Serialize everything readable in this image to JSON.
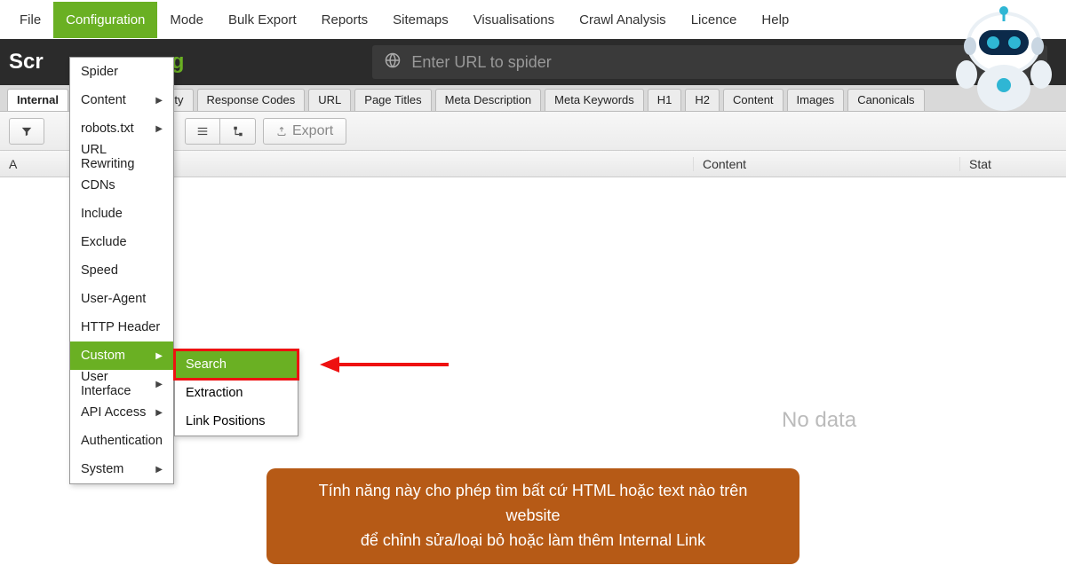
{
  "menubar": {
    "items": [
      "File",
      "Configuration",
      "Mode",
      "Bulk Export",
      "Reports",
      "Sitemaps",
      "Visualisations",
      "Crawl Analysis",
      "Licence",
      "Help"
    ],
    "active_index": 1
  },
  "logo": {
    "part1": "Scr",
    "part2": "rog"
  },
  "url_input": {
    "placeholder": "Enter URL to spider"
  },
  "tabs": {
    "items": [
      "Internal",
      "urity",
      "Response Codes",
      "URL",
      "Page Titles",
      "Meta Description",
      "Meta Keywords",
      "H1",
      "H2",
      "Content",
      "Images",
      "Canonicals"
    ],
    "active_index": 0
  },
  "filter_row": {
    "export_label": "Export"
  },
  "table_columns": {
    "a": "A",
    "content": "Content",
    "stat": "Stat"
  },
  "dropdown": {
    "items": [
      {
        "label": "Spider",
        "has_submenu": false
      },
      {
        "label": "Content",
        "has_submenu": true
      },
      {
        "label": "robots.txt",
        "has_submenu": true
      },
      {
        "label": "URL Rewriting",
        "has_submenu": false
      },
      {
        "label": "CDNs",
        "has_submenu": false
      },
      {
        "label": "Include",
        "has_submenu": false
      },
      {
        "label": "Exclude",
        "has_submenu": false
      },
      {
        "label": "Speed",
        "has_submenu": false
      },
      {
        "label": "User-Agent",
        "has_submenu": false
      },
      {
        "label": "HTTP Header",
        "has_submenu": false
      },
      {
        "label": "Custom",
        "has_submenu": true,
        "highlighted": true
      },
      {
        "label": "User Interface",
        "has_submenu": true
      },
      {
        "label": "API Access",
        "has_submenu": true
      },
      {
        "label": "Authentication",
        "has_submenu": false
      },
      {
        "label": "System",
        "has_submenu": true
      }
    ]
  },
  "submenu": {
    "items": [
      {
        "label": "Search",
        "highlighted": true
      },
      {
        "label": "Extraction",
        "highlighted": false
      },
      {
        "label": "Link Positions",
        "highlighted": false
      }
    ]
  },
  "no_data_text": "No data",
  "caption": {
    "line1": "Tính năng này cho phép tìm bất cứ HTML hoặc text nào trên website",
    "line2": "để chỉnh sửa/loại bỏ hoặc làm thêm Internal Link"
  }
}
